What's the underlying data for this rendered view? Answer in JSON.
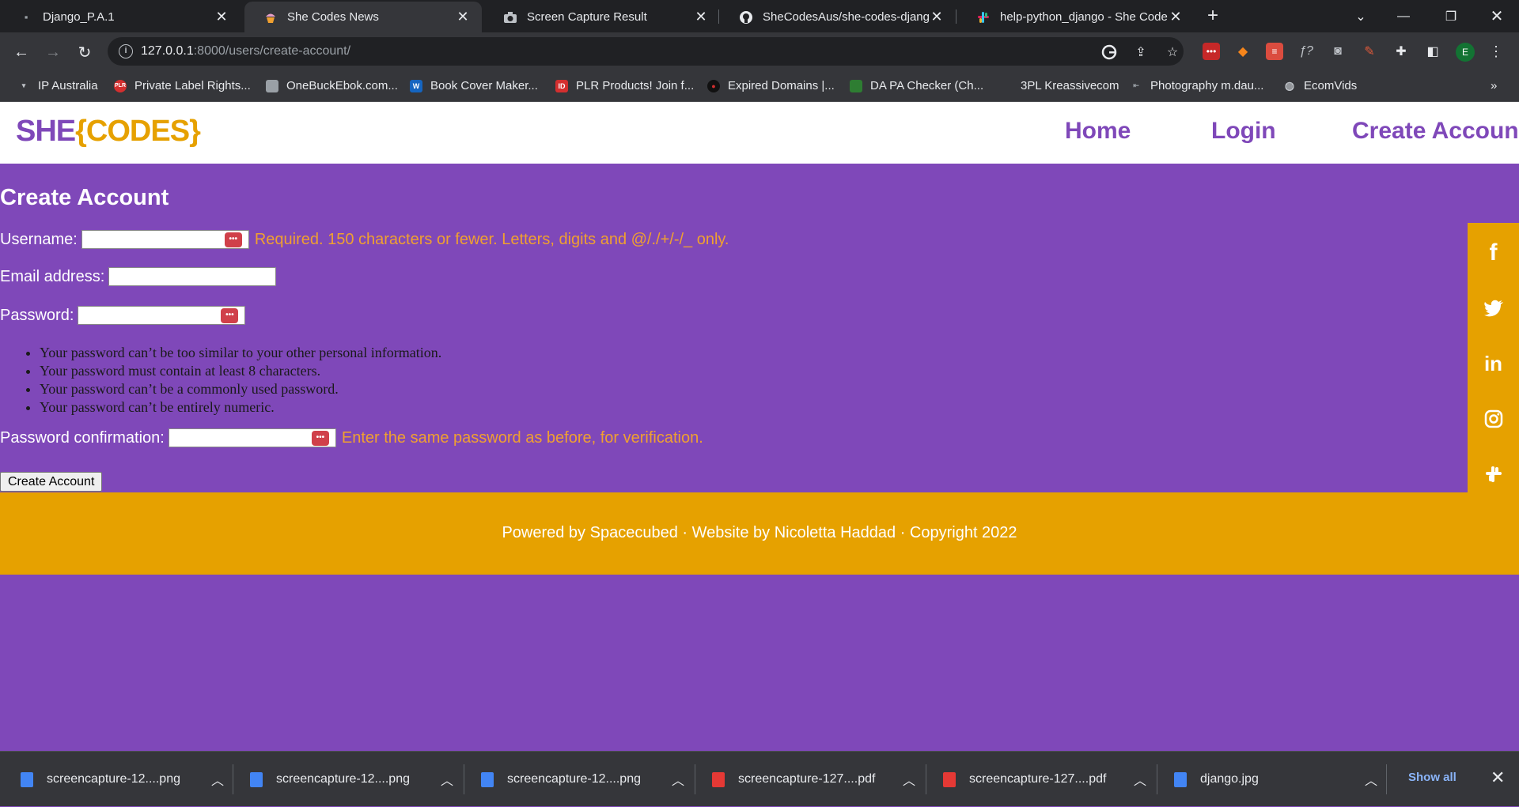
{
  "browser": {
    "tabs": [
      {
        "title": "Django_P.A.1",
        "icon": "django-icon",
        "active": false
      },
      {
        "title": "She Codes News",
        "icon": "cupcake-icon",
        "active": true
      },
      {
        "title": "Screen Capture Result",
        "icon": "camera-icon",
        "active": false
      },
      {
        "title": "SheCodesAus/she-codes-django",
        "icon": "github-icon",
        "active": false
      },
      {
        "title": "help-python_django - She Codes",
        "icon": "slack-icon",
        "active": false
      }
    ],
    "url_host": "127.0.0.1",
    "url_path": ":8000/users/create-account/",
    "profile_initial": "E",
    "bookmarks": [
      "IP Australia",
      "Private Label Rights...",
      "OneBuckEbok.com...",
      "Book Cover Maker...",
      "PLR Products! Join f...",
      "Expired Domains |...",
      "DA PA Checker (Ch...",
      "3PL Kreassivecom",
      "Photography m.dau...",
      "EcomVids"
    ],
    "bookmark_badges": {
      "plr": "PLR",
      "id": "ID"
    }
  },
  "site": {
    "logo_she": "SHE",
    "logo_codes": "{CODES}",
    "nav": {
      "home": "Home",
      "login": "Login",
      "create": "Create Account"
    },
    "page_title": "Create Account",
    "form": {
      "username_label": "Username:",
      "username_help": "Required. 150 characters or fewer. Letters, digits and @/./+/-/_ only.",
      "email_label": "Email address:",
      "password_label": "Password:",
      "password_rules": [
        "Your password can’t be too similar to your other personal information.",
        "Your password must contain at least 8 characters.",
        "Your password can’t be a commonly used password.",
        "Your password can’t be entirely numeric."
      ],
      "confirm_label": "Password confirmation:",
      "confirm_help": "Enter the same password as before, for verification.",
      "submit_label": "Create Account",
      "password_manager_badge": "•••"
    },
    "social_icons": [
      "facebook-icon",
      "twitter-icon",
      "linkedin-icon",
      "instagram-icon",
      "slack-icon"
    ],
    "social_glyphs": {
      "facebook": "f",
      "linkedin": "in"
    },
    "footer": "Powered by Spacecubed · Website by Nicoletta Haddad · Copyright 2022",
    "colors": {
      "purple": "#7f48b9",
      "gold": "#e6a100",
      "help": "#f0a030"
    }
  },
  "downloads": {
    "items": [
      {
        "name": "screencapture-12....png",
        "type": "png"
      },
      {
        "name": "screencapture-12....png",
        "type": "png"
      },
      {
        "name": "screencapture-12....png",
        "type": "png"
      },
      {
        "name": "screencapture-127....pdf",
        "type": "pdf"
      },
      {
        "name": "screencapture-127....pdf",
        "type": "pdf"
      },
      {
        "name": "django.jpg",
        "type": "jpg"
      }
    ],
    "show_all": "Show all"
  }
}
